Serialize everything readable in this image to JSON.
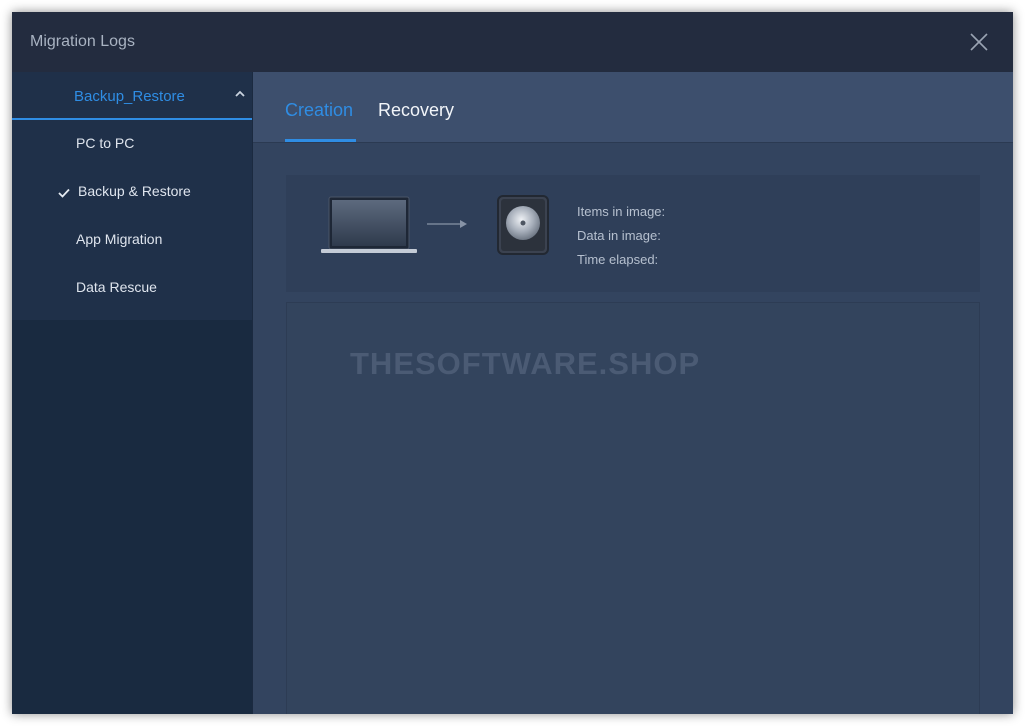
{
  "window": {
    "title": "Migration Logs",
    "close_icon": "close-icon"
  },
  "sidebar": {
    "group_label": "Backup_Restore",
    "group_icon": "chevron-up-icon",
    "items": [
      {
        "label": "PC to PC",
        "checked": false
      },
      {
        "label": "Backup & Restore",
        "checked": true
      },
      {
        "label": "App Migration",
        "checked": false
      },
      {
        "label": "Data Rescue",
        "checked": false
      }
    ],
    "check_icon": "checkmark-icon"
  },
  "tabs": [
    {
      "label": "Creation",
      "active": true
    },
    {
      "label": "Recovery",
      "active": false
    }
  ],
  "info": {
    "source_icon": "laptop-icon",
    "arrow_icon": "arrow-right-icon",
    "target_icon": "disk-image-icon",
    "labels": [
      "Items in image:",
      "Data in image:",
      "Time elapsed:"
    ]
  },
  "log": {
    "watermark": "THESOFTWARE.SHOP"
  },
  "colors": {
    "accent": "#2f8de4",
    "sidebar_bg": "#192a40",
    "main_bg": "#33445f",
    "titlebar_bg": "#232c3f"
  }
}
